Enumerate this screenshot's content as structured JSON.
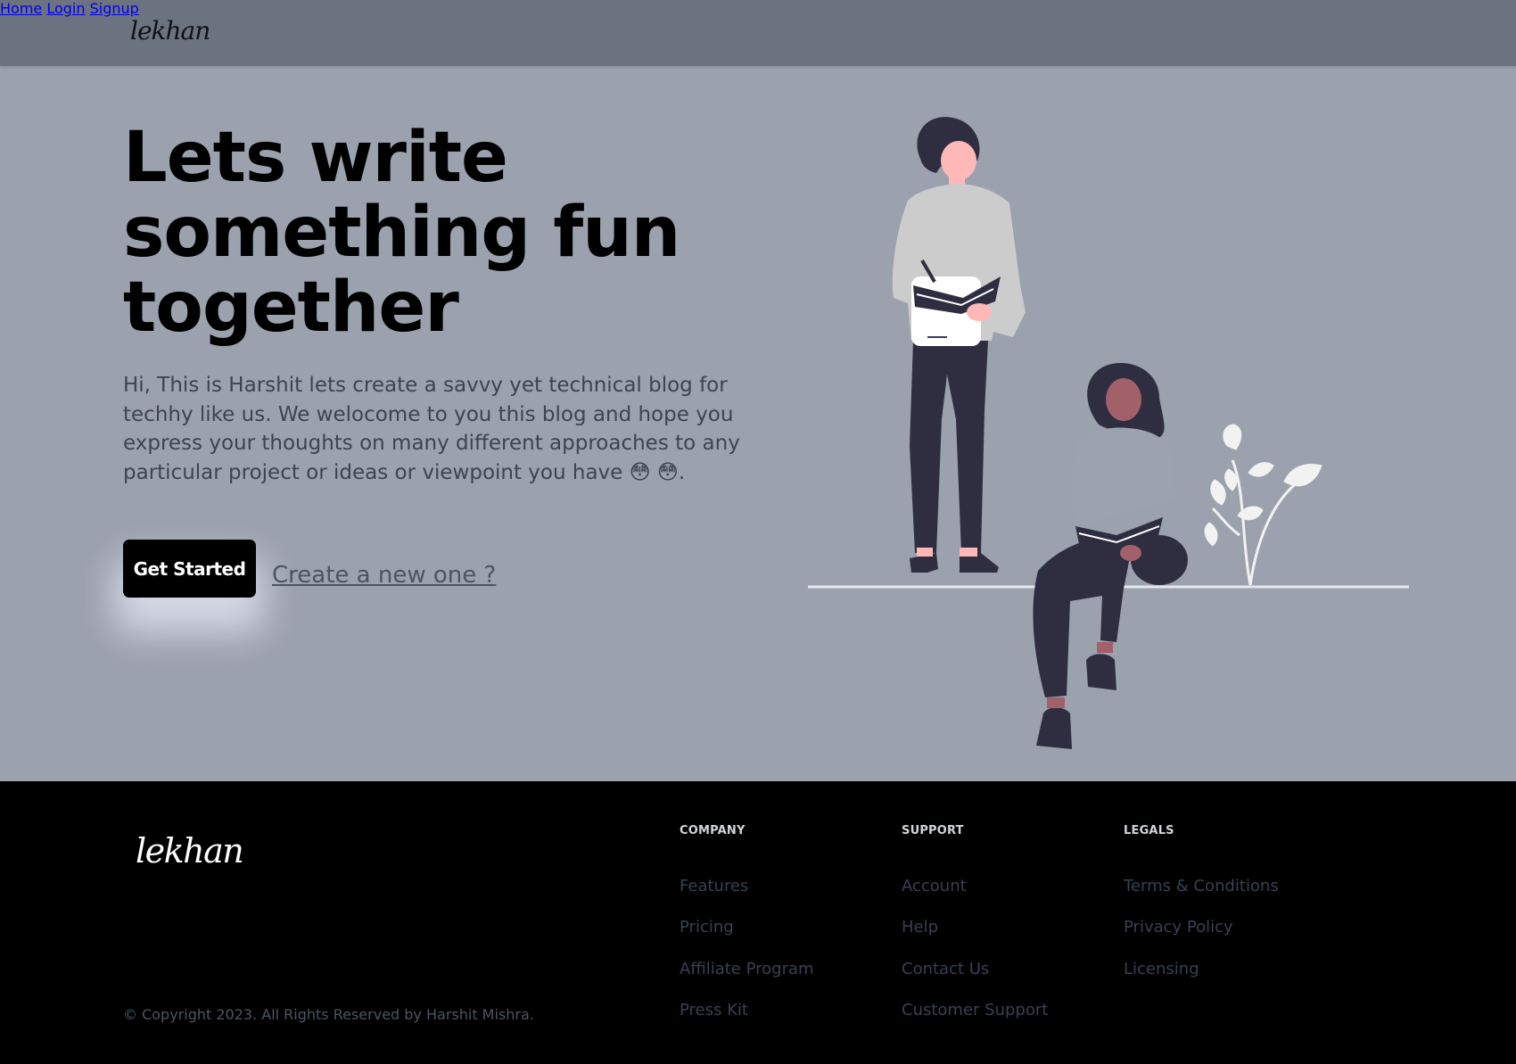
{
  "header": {
    "logo": "lekhan",
    "nav": [
      {
        "label": "Home"
      },
      {
        "label": "Login"
      },
      {
        "label": "Signup"
      }
    ]
  },
  "hero": {
    "title": "Lets write something fun together",
    "description": "Hi, This is Harshit lets create a savvy yet technical blog for techhy like us. We welocome to you this blog and hope you express your thoughts on many different approaches to any particular project or ideas or viewpoint you have 😳 😳.",
    "cta_label": "Get Started",
    "secondary_link": "Create a new one ?"
  },
  "footer": {
    "logo": "lekhan",
    "copyright": "© Copyright 2023. All Rights Reserved by Harshit Mishra.",
    "columns": [
      {
        "heading": "COMPANY",
        "links": [
          "Features",
          "Pricing",
          "Affiliate Program",
          "Press Kit"
        ]
      },
      {
        "heading": "SUPPORT",
        "links": [
          "Account",
          "Help",
          "Contact Us",
          "Customer Support"
        ]
      },
      {
        "heading": "LEGALS",
        "links": [
          "Terms & Conditions",
          "Privacy Policy",
          "Licensing"
        ]
      }
    ]
  },
  "colors": {
    "header_bg": "#6b7280",
    "hero_bg": "#9ba1ad",
    "footer_bg": "#000000",
    "button_bg": "#000000"
  }
}
